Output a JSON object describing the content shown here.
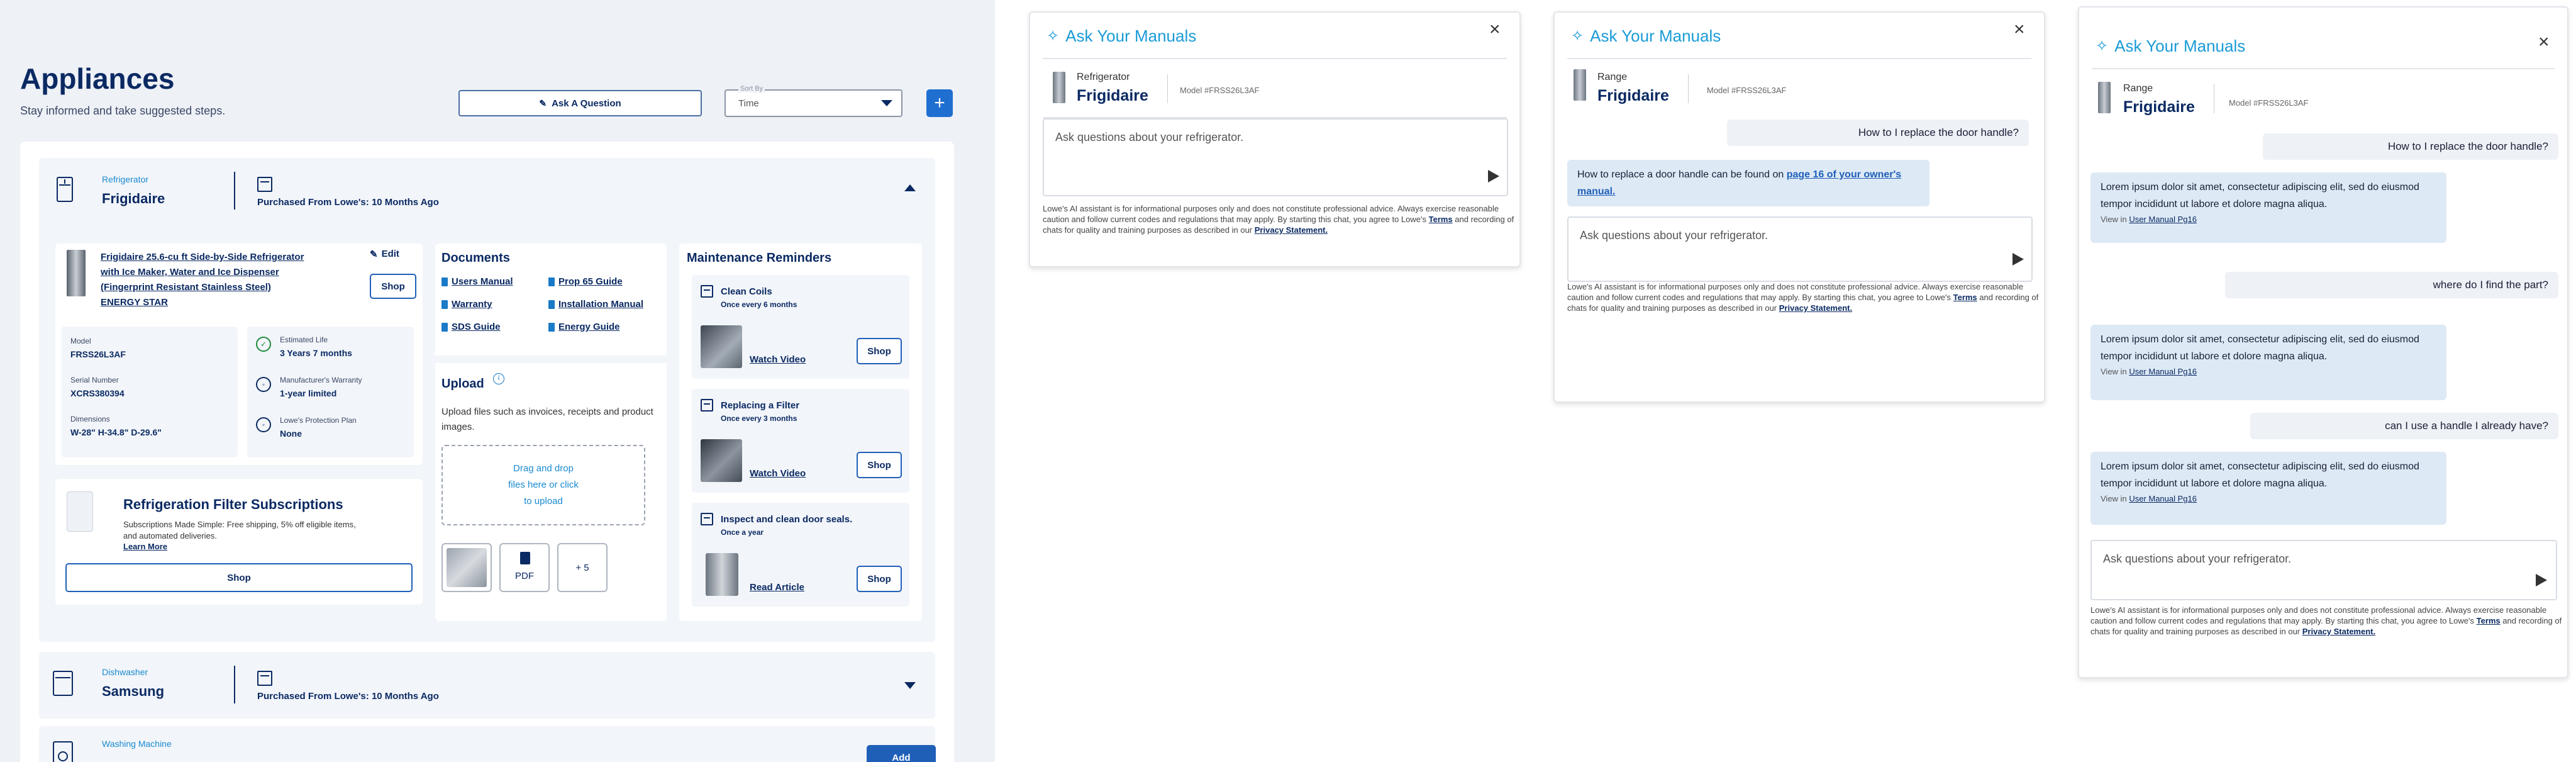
{
  "page": {
    "title": "Appliances",
    "subtitle": "Stay informed and take suggested steps.",
    "ask_button": "Ask A Question",
    "sort_label": "Sort By",
    "sort_value": "Time",
    "add_symbol": "+"
  },
  "refrigerator": {
    "category": "Refrigerator",
    "brand": "Frigidaire",
    "purchased": "Purchased From Lowe's: 10 Months Ago",
    "product_title": "Frigidaire 25.6-cu ft Side-by-Side Refrigerator with Ice Maker, Water and Ice Dispenser (Fingerprint Resistant Stainless Steel) ENERGY STAR",
    "edit": "Edit",
    "shop": "Shop",
    "model_label": "Model",
    "model_value": "FRSS26L3AF",
    "serial_label": "Serial Number",
    "serial_value": "XCRS380394",
    "dimensions_label": "Dimensions",
    "dimensions_value": "W-28\" H-34.8\" D-29.6\"",
    "life_label": "Estimated Life",
    "life_value": "3 Years 7 months",
    "warranty_label": "Manufacturer's Warranty",
    "warranty_value": "1-year limited",
    "protection_label": "Lowe's Protection Plan",
    "protection_value": "None",
    "filter_title": "Refrigeration Filter Subscriptions",
    "filter_text": "Subscriptions Made Simple: Free shipping, 5% off eligible items, and automated deliveries.",
    "filter_learn": "Learn More",
    "filter_shop": "Shop"
  },
  "documents": {
    "title": "Documents",
    "links": [
      "Users Manual",
      "Prop 65 Guide",
      "Warranty",
      "Installation Manual",
      "SDS Guide",
      "Energy Guide"
    ]
  },
  "upload": {
    "title": "Upload",
    "info_icon": "i",
    "description": "Upload files such as invoices, receipts and product images.",
    "drop_text": "Drag and drop files here or click to upload",
    "pdf_label": "PDF",
    "more_label": "+ 5"
  },
  "maintenance": {
    "title": "Maintenance Reminders",
    "items": [
      {
        "title": "Clean Coils",
        "frequency": "Once every 6 months",
        "link": "Watch Video",
        "shop": "Shop"
      },
      {
        "title": "Replacing a Filter",
        "frequency": "Once every 3 months",
        "link": "Watch Video",
        "shop": "Shop"
      },
      {
        "title": "Inspect and clean door seals.",
        "frequency": "Once a year",
        "link": "Read Article",
        "shop": "Shop"
      }
    ]
  },
  "dishwasher": {
    "category": "Dishwasher",
    "brand": "Samsung",
    "purchased": "Purchased From Lowe's: 10 Months Ago"
  },
  "washer": {
    "category": "Washing Machine",
    "add": "Add"
  },
  "chat": {
    "title": "Ask Your Manuals",
    "close": "×",
    "placeholder": "Ask questions about your refrigerator.",
    "disclaimer_1": "Lowe's AI assistant is for informational purposes only and does not constitute professional advice. Always exercise reasonable caution and follow current codes and regulations that may apply. By starting this chat, you agree to Lowe's",
    "terms": "Terms",
    "disclaimer_2": "and recording of chats for quality and training purposes as described in our",
    "privacy": "Privacy Statement.",
    "panel1": {
      "category": "Refrigerator",
      "brand": "Frigidaire",
      "model": "Model #FRSS26L3AF"
    },
    "panel2": {
      "category": "Range",
      "brand": "Frigidaire",
      "model": "Model #FRSS26L3AF",
      "user_msg": "How to I replace the door handle?",
      "bot_text": "How to replace a door handle can be found on",
      "bot_link": "page 16 of your owner's manual."
    },
    "panel3": {
      "category": "Range",
      "brand": "Frigidaire",
      "model": "Model #FRSS26L3AF",
      "messages": [
        {
          "user": "How to I replace the door handle?",
          "bot": "Lorem ipsum dolor sit amet, consectetur adipiscing elit, sed do eiusmod tempor incididunt ut labore et dolore magna aliqua.",
          "view": "View in",
          "view_link": "User Manual Pg16"
        },
        {
          "user": "where do I find the part?",
          "bot": "Lorem ipsum dolor sit amet, consectetur adipiscing elit, sed do eiusmod tempor incididunt ut labore et dolore magna aliqua.",
          "view": "View in",
          "view_link": "User Manual Pg16"
        },
        {
          "user": "can I use a handle I already have?",
          "bot": "Lorem ipsum dolor sit amet, consectetur adipiscing elit, sed do eiusmod tempor incididunt ut labore et dolore magna aliqua.",
          "view": "View in",
          "view_link": "User Manual Pg16"
        }
      ]
    }
  },
  "icons": [
    "sparkle-icon",
    "close-icon",
    "send-icon",
    "calendar-icon",
    "chevron-up-icon",
    "chevron-down-icon",
    "pencil-icon",
    "check-circle-icon",
    "document-icon",
    "info-icon",
    "fridge-icon",
    "dishwasher-icon",
    "washer-icon",
    "filter-icon"
  ],
  "colors": {
    "navy": "#0b2a63",
    "accent": "#1a9bd7",
    "primary_button": "#1f6fd1",
    "bot_bubble": "#dde9f5"
  }
}
